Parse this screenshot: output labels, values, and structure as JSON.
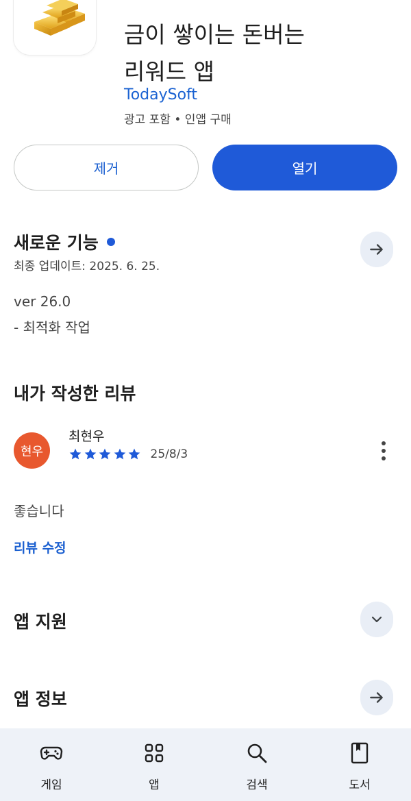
{
  "app": {
    "icon": "gold-bars-icon",
    "title_lines": [
      "금이 쌓이는 돈버는",
      "리워드 앱"
    ],
    "developer": "TodaySoft",
    "meta": "광고 포함 • 인앱 구매"
  },
  "actions": {
    "remove_label": "제거",
    "open_label": "열기"
  },
  "whats_new": {
    "title": "새로운 기능",
    "updated": "최종 업데이트: 2025. 6. 25.",
    "version": "ver 26.0",
    "note": "- 최적화 작업"
  },
  "my_review": {
    "title": "내가 작성한 리뷰",
    "avatar_text": "현우",
    "reviewer": "최현우",
    "rating": 5,
    "date": "25/8/3",
    "text": "좋습니다",
    "edit_label": "리뷰 수정"
  },
  "support": {
    "title": "앱 지원"
  },
  "info": {
    "title": "앱 정보"
  },
  "bottom_nav": [
    {
      "label": "게임",
      "icon": "gamepad-icon"
    },
    {
      "label": "앱",
      "icon": "apps-grid-icon"
    },
    {
      "label": "검색",
      "icon": "search-icon"
    },
    {
      "label": "도서",
      "icon": "book-icon"
    }
  ],
  "colors": {
    "accent": "#1f5ad8",
    "link": "#1a5fd0",
    "avatar": "#e8582e",
    "nav_bg": "#eef2f8"
  }
}
